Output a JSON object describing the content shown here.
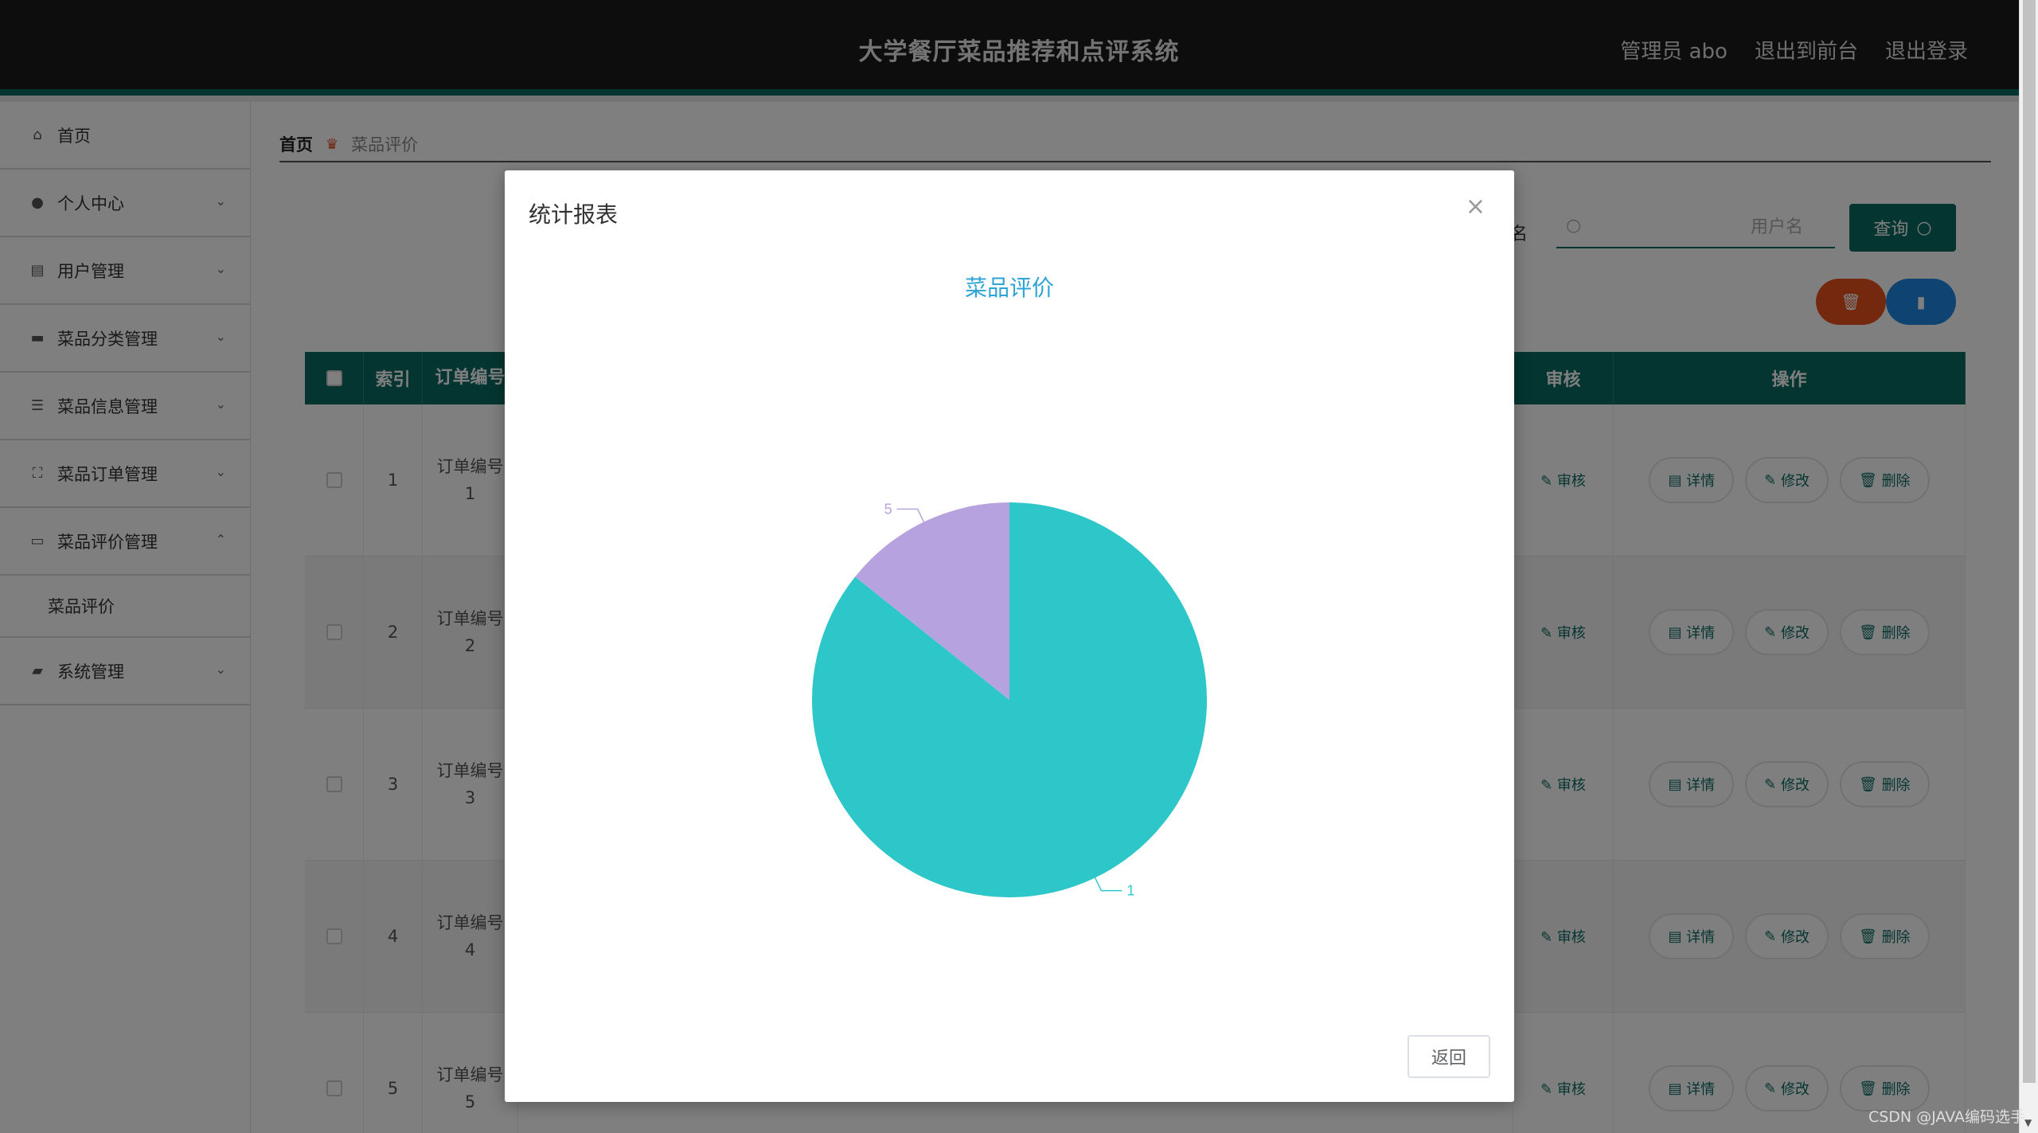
{
  "header": {
    "title": "大学餐厅菜品推荐和点评系统",
    "links": [
      "管理员 abo",
      "退出到前台",
      "退出登录"
    ]
  },
  "sidebar": {
    "items": [
      {
        "label": "首页",
        "icon": "home-icon",
        "chevron": ""
      },
      {
        "label": "个人中心",
        "icon": "user-icon",
        "chevron": "⌄"
      },
      {
        "label": "用户管理",
        "icon": "clipboard-icon",
        "chevron": "⌄"
      },
      {
        "label": "菜品分类管理",
        "icon": "briefcase-icon",
        "chevron": "⌄"
      },
      {
        "label": "菜品信息管理",
        "icon": "list-icon",
        "chevron": "⌄"
      },
      {
        "label": "菜品订单管理",
        "icon": "scan-icon",
        "chevron": "⌄"
      },
      {
        "label": "菜品评价管理",
        "icon": "comment-icon",
        "chevron": "⌃"
      }
    ],
    "subitem": "菜品评价",
    "last_item": {
      "label": "系统管理",
      "icon": "ticket-icon",
      "chevron": "⌄"
    }
  },
  "breadcrumb": {
    "home": "首页",
    "current": "菜品评价"
  },
  "search": {
    "label_fragment": "户名",
    "placeholder": "用户名",
    "button": "查询"
  },
  "table": {
    "headers": {
      "index": "索引",
      "order": "订单编号",
      "audit": "审核",
      "ops": "操作"
    },
    "rows": [
      {
        "index": "1",
        "order_label": "订单编号",
        "order_no": "1"
      },
      {
        "index": "2",
        "order_label": "订单编号",
        "order_no": "2"
      },
      {
        "index": "3",
        "order_label": "订单编号",
        "order_no": "3"
      },
      {
        "index": "4",
        "order_label": "订单编号",
        "order_no": "4"
      },
      {
        "index": "5",
        "order_label": "订单编号",
        "order_no": "5"
      }
    ],
    "audit_label": "审核",
    "op_labels": {
      "detail": "详情",
      "edit": "修改",
      "delete": "删除"
    }
  },
  "modal": {
    "title": "统计报表",
    "close": "×",
    "back_button": "返回"
  },
  "chart_data": {
    "type": "pie",
    "title": "菜品评价",
    "slices": [
      {
        "label": "1",
        "value": 6,
        "color": "#2ec7c9"
      },
      {
        "label": "5",
        "value": 1,
        "color": "#b6a2de"
      }
    ]
  },
  "watermark": "CSDN @JAVA编码选手"
}
